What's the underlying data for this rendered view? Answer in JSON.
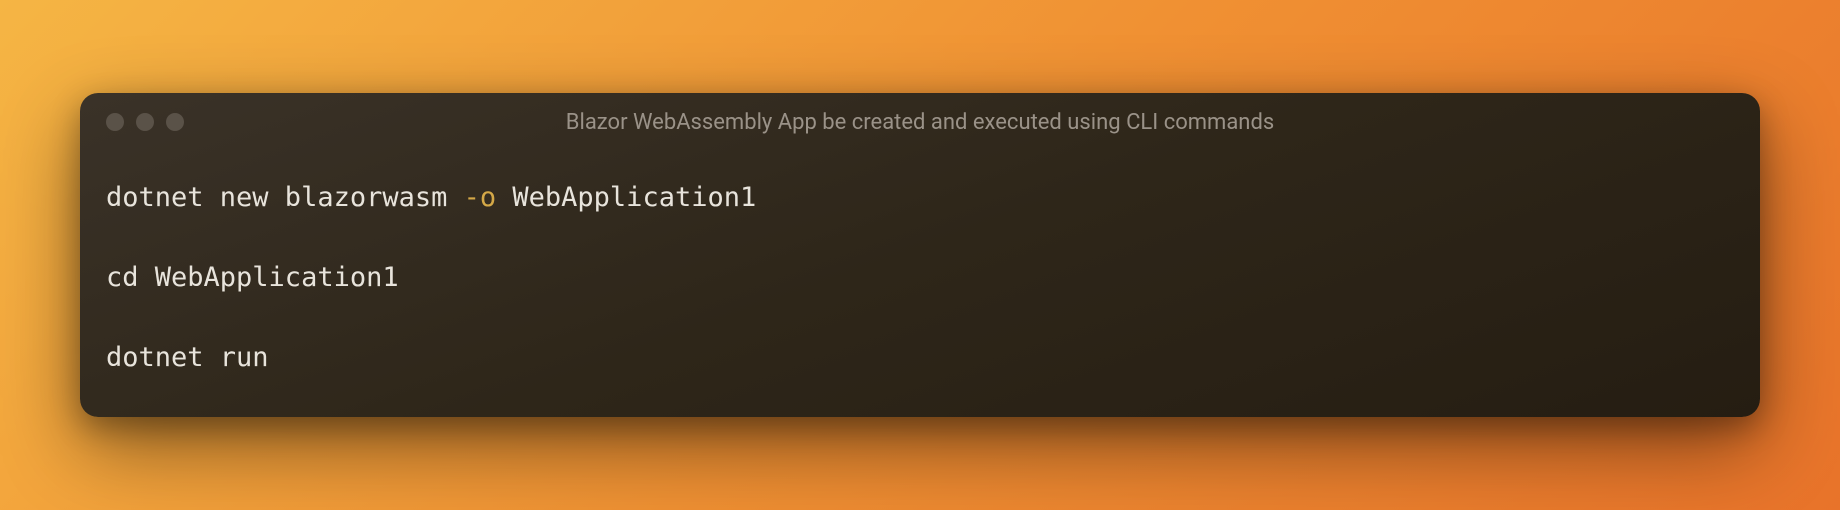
{
  "window": {
    "title": "Blazor WebAssembly App be created and executed using CLI commands"
  },
  "code": {
    "line1_part1": "dotnet new blazorwasm ",
    "line1_flag": "-o",
    "line1_part2": " WebApplication1",
    "line2": "cd WebApplication1",
    "line3": "dotnet run"
  }
}
